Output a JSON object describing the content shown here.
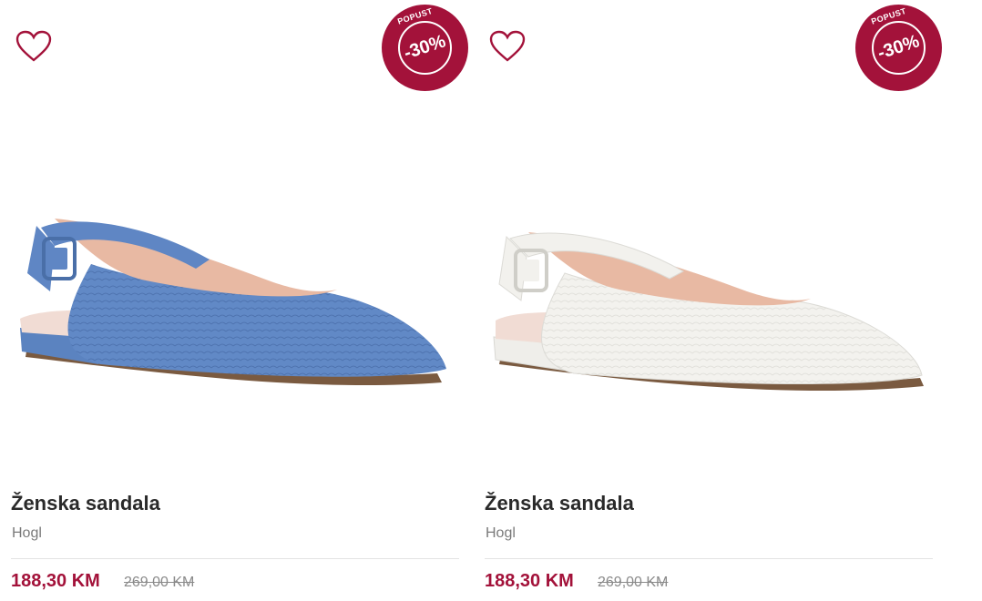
{
  "products": [
    {
      "title": "Ženska sandala",
      "brand": "Hogl",
      "price": "188,30 KM",
      "old_price": "269,00 KM",
      "badge": {
        "label": "POPUST",
        "discount": "-30%"
      },
      "color": "#5f86c4"
    },
    {
      "title": "Ženska sandala",
      "brand": "Hogl",
      "price": "188,30 KM",
      "old_price": "269,00 KM",
      "badge": {
        "label": "POPUST",
        "discount": "-30%"
      },
      "color": "#f1f0ec"
    }
  ],
  "theme": {
    "accent": "#a3123a"
  }
}
